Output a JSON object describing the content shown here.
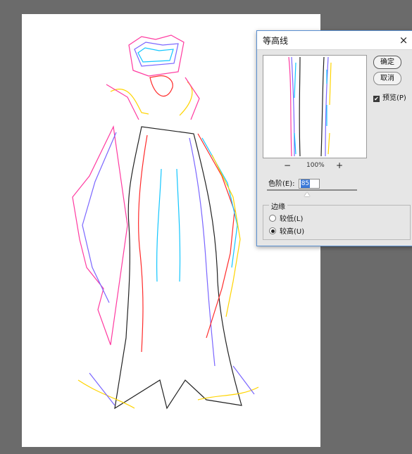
{
  "dialog": {
    "title": "等高线",
    "close_label": "×",
    "zoom_out_icon": "−",
    "zoom_level": "100%",
    "zoom_in_icon": "+",
    "ok_label": "确定",
    "cancel_label": "取消",
    "preview_check": "✔",
    "preview_label": "预览(P)",
    "level_label": "色阶(E):",
    "level_value": "85",
    "edge_title": "边缘",
    "radio_lower": "较低(L)",
    "radio_upper": "较高(U)",
    "selected_edge": "较高(U)",
    "preview_checked": true
  },
  "colors": {
    "workspace": "#6b6b6b",
    "dialog_bg": "#e6e6e6",
    "accent": "#3a78d8"
  }
}
